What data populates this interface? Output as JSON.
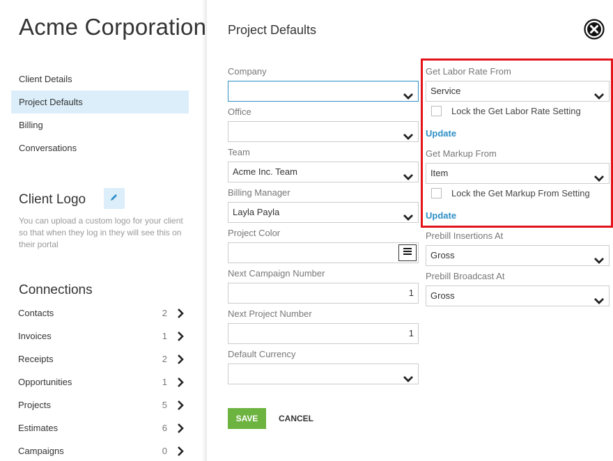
{
  "sidebar": {
    "client_name": "Acme Corporation",
    "nav": [
      {
        "label": "Client Details",
        "active": false
      },
      {
        "label": "Project Defaults",
        "active": true
      },
      {
        "label": "Billing",
        "active": false
      },
      {
        "label": "Conversations",
        "active": false
      }
    ],
    "logo": {
      "title": "Client Logo",
      "edit_icon": "pencil-icon",
      "description": "You can upload a custom logo for your client so that when they log in they will see this on their portal"
    },
    "connections": {
      "title": "Connections",
      "items": [
        {
          "label": "Contacts",
          "count": "2"
        },
        {
          "label": "Invoices",
          "count": "1"
        },
        {
          "label": "Receipts",
          "count": "2"
        },
        {
          "label": "Opportunities",
          "count": "1"
        },
        {
          "label": "Projects",
          "count": "5"
        },
        {
          "label": "Estimates",
          "count": "6"
        },
        {
          "label": "Campaigns",
          "count": "0"
        }
      ]
    }
  },
  "panel": {
    "title": "Project Defaults",
    "close_icon": "close-circle-icon",
    "left": {
      "company": {
        "label": "Company",
        "value": ""
      },
      "office": {
        "label": "Office",
        "value": ""
      },
      "team": {
        "label": "Team",
        "value": "Acme Inc. Team"
      },
      "billing_manager": {
        "label": "Billing Manager",
        "value": "Layla Payla"
      },
      "project_color": {
        "label": "Project Color",
        "value": ""
      },
      "next_campaign_number": {
        "label": "Next Campaign Number",
        "value": "1"
      },
      "next_project_number": {
        "label": "Next Project Number",
        "value": "1"
      },
      "default_currency": {
        "label": "Default Currency",
        "value": ""
      }
    },
    "right": {
      "labor_rate": {
        "label": "Get Labor Rate From",
        "value": "Service",
        "lock_label": "Lock the Get Labor Rate Setting",
        "update_label": "Update"
      },
      "markup": {
        "label": "Get Markup From",
        "value": "Item",
        "lock_label": "Lock the Get Markup From Setting",
        "update_label": "Update"
      },
      "prebill_insertions": {
        "label": "Prebill Insertions At",
        "value": "Gross"
      },
      "prebill_broadcast": {
        "label": "Prebill Broadcast At",
        "value": "Gross"
      }
    },
    "actions": {
      "save_label": "SAVE",
      "cancel_label": "CANCEL"
    },
    "colors": {
      "accent": "#2e8fc5",
      "save": "#6db33f",
      "highlight": "#e3131b",
      "active_nav": "#dbeefa"
    }
  }
}
